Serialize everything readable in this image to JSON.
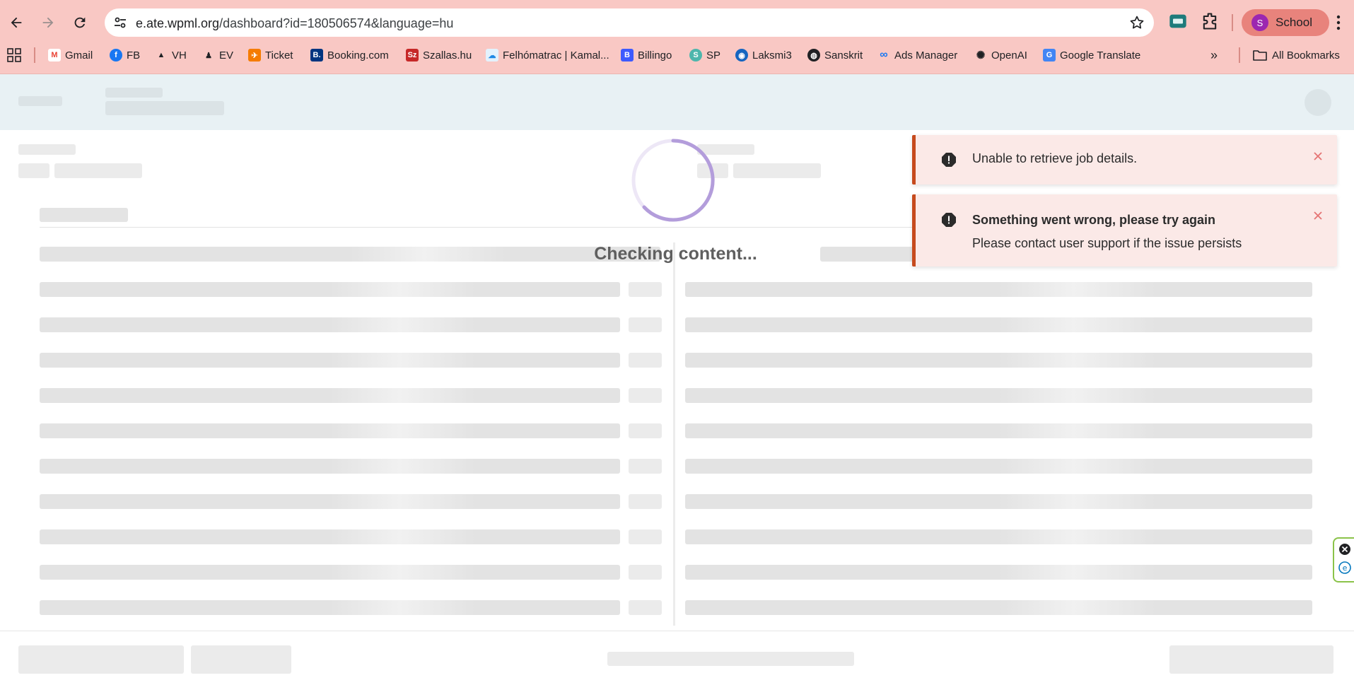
{
  "browser": {
    "url_host": "e.ate.wpml.org",
    "url_path": "/dashboard?id=180506574&language=hu",
    "profile_initial": "S",
    "profile_name": "School",
    "bookmarks": [
      {
        "label": "Gmail",
        "icon": "gmail-icon"
      },
      {
        "label": "FB",
        "icon": "facebook-icon"
      },
      {
        "label": "VH",
        "icon": "vh-icon"
      },
      {
        "label": "EV",
        "icon": "ev-icon"
      },
      {
        "label": "Ticket",
        "icon": "ticket-icon"
      },
      {
        "label": "Booking.com",
        "icon": "booking-icon"
      },
      {
        "label": "Szallas.hu",
        "icon": "szallas-icon"
      },
      {
        "label": "Felhómatrac | Kamal...",
        "icon": "felhomatrac-icon"
      },
      {
        "label": "Billingo",
        "icon": "billingo-icon"
      },
      {
        "label": "SP",
        "icon": "sp-icon"
      },
      {
        "label": "Laksmi3",
        "icon": "laksmi-icon"
      },
      {
        "label": "Sanskrit",
        "icon": "globe-icon"
      },
      {
        "label": "Ads Manager",
        "icon": "meta-icon"
      },
      {
        "label": "OpenAI",
        "icon": "openai-icon"
      },
      {
        "label": "Google Translate",
        "icon": "translate-icon"
      }
    ],
    "all_bookmarks_label": "All Bookmarks"
  },
  "loading": {
    "text": "Checking content..."
  },
  "toasts": [
    {
      "title": "Unable to retrieve job details.",
      "message": ""
    },
    {
      "title": "Something went wrong, please try again",
      "message": "Please contact user support if the issue persists"
    }
  ],
  "colors": {
    "chrome_bg": "#f9c8c4",
    "toast_bg": "#fbe9e7",
    "toast_accent": "#c64a1d",
    "spinner": "#b39ddb",
    "header_bg": "#e8f1f4"
  }
}
